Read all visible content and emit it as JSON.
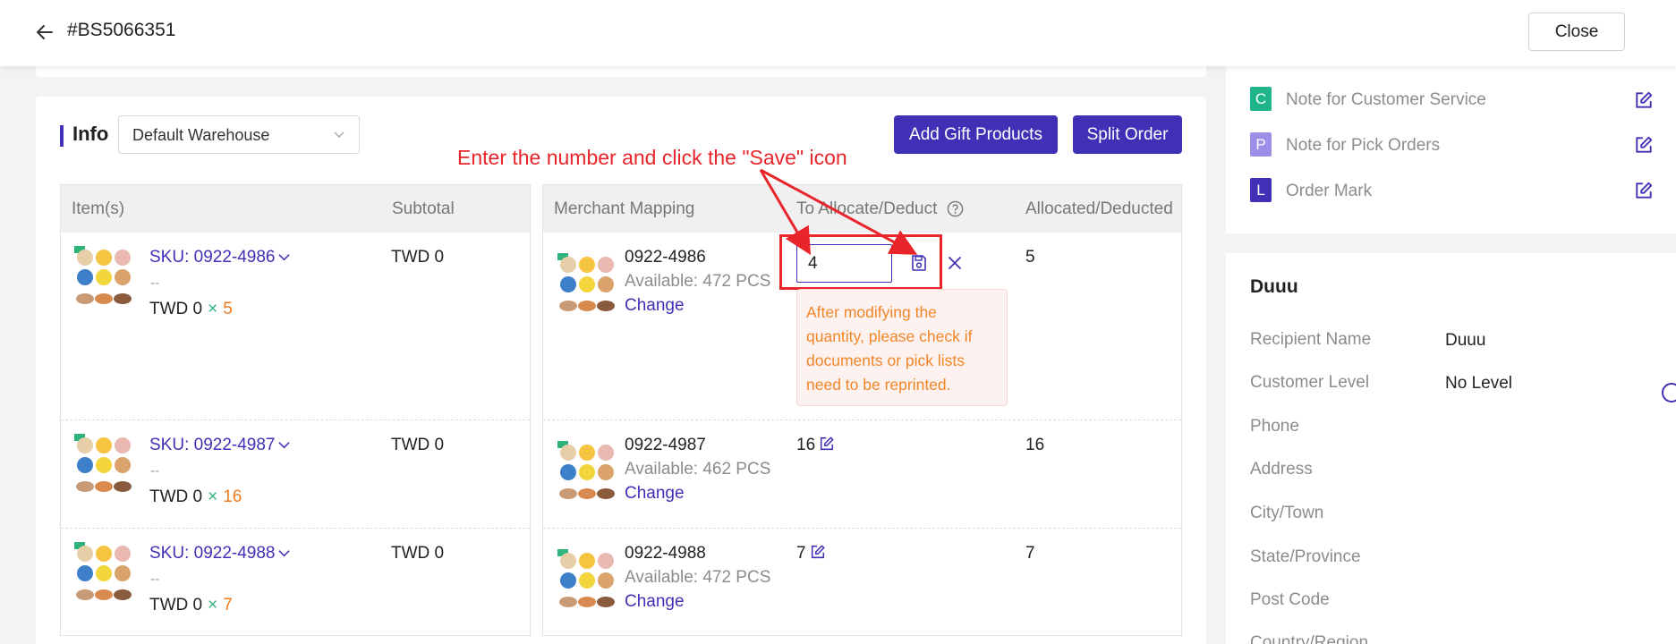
{
  "header": {
    "order_id": "#BS5066351",
    "close_label": "Close"
  },
  "info": {
    "title": "Info",
    "warehouse": "Default Warehouse",
    "gift_button": "Add Gift Products",
    "split_button": "Split Order"
  },
  "annotation": {
    "text": "Enter the number and click the \"Save\" icon",
    "color": "#e8252b"
  },
  "items_table": {
    "headers": [
      "Item(s)",
      "Subtotal"
    ],
    "rows": [
      {
        "sku": "SKU: 0922-4986",
        "dash": "--",
        "price": "TWD 0",
        "times": "×",
        "qty": "5",
        "subtotal": "TWD 0"
      },
      {
        "sku": "SKU: 0922-4987",
        "dash": "--",
        "price": "TWD 0",
        "times": "×",
        "qty": "16",
        "subtotal": "TWD 0"
      },
      {
        "sku": "SKU: 0922-4988",
        "dash": "--",
        "price": "TWD 0",
        "times": "×",
        "qty": "7",
        "subtotal": "TWD 0"
      }
    ]
  },
  "mapping_table": {
    "headers": [
      "Merchant Mapping",
      "To Allocate/Deduct",
      "Allocated/Deducted"
    ],
    "rows": [
      {
        "sku": "0922-4986",
        "available": "Available: 472 PCS",
        "change": "Change",
        "to_allocate": "4",
        "allocated": "5"
      },
      {
        "sku": "0922-4987",
        "available": "Available: 462 PCS",
        "change": "Change",
        "to_allocate": "16",
        "allocated": "16"
      },
      {
        "sku": "0922-4988",
        "available": "Available: 472 PCS",
        "change": "Change",
        "to_allocate": "7",
        "allocated": "7"
      }
    ],
    "tooltip": "After modifying the quantity, please check if documents or pick lists need to be reprinted."
  },
  "notes": [
    {
      "badge": "C",
      "label": "Note for Customer Service",
      "color": "#1fb58a"
    },
    {
      "badge": "P",
      "label": "Note for Pick Orders",
      "color": "#9d8fe8"
    },
    {
      "badge": "L",
      "label": "Order Mark",
      "color": "#3f30b6"
    }
  ],
  "recipient": {
    "title": "Duuu",
    "fields": [
      {
        "label": "Recipient Name",
        "value": "Duuu"
      },
      {
        "label": "Customer Level",
        "value": "No Level"
      },
      {
        "label": "Phone",
        "value": ""
      },
      {
        "label": "Address",
        "value": ""
      },
      {
        "label": "City/Town",
        "value": ""
      },
      {
        "label": "State/Province",
        "value": ""
      },
      {
        "label": "Post Code",
        "value": ""
      },
      {
        "label": "Country/Region",
        "value": ""
      }
    ]
  },
  "colors": {
    "accent": "#3f30b6",
    "annotation_red": "#e8252b",
    "quantity_orange": "#f07a1c",
    "tooltip_text": "#f0862a"
  }
}
